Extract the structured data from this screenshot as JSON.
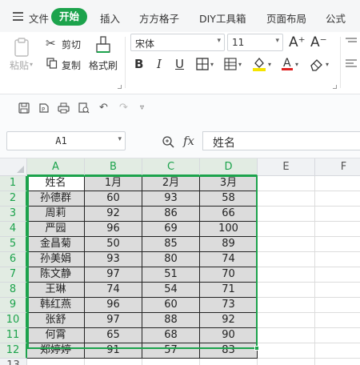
{
  "menubar": {
    "items": [
      "文件",
      "开始",
      "插入",
      "方方格子",
      "DIY工具箱",
      "页面布局",
      "公式"
    ],
    "active": "开始"
  },
  "ribbon": {
    "paste": "粘贴",
    "cut": "剪切",
    "copy": "复制",
    "format_painter": "格式刷",
    "font_name": "宋体",
    "font_size": "11",
    "bold": "B",
    "italic": "I",
    "underline": "U",
    "grow_font": "A⁺",
    "shrink_font": "A⁻"
  },
  "formula": {
    "name_box": "A1",
    "fx_label": "fx",
    "content": "姓名"
  },
  "grid": {
    "columns": [
      "A",
      "B",
      "C",
      "D",
      "E",
      "F"
    ],
    "row_numbers": [
      "1",
      "2",
      "3",
      "4",
      "5",
      "6",
      "7",
      "8",
      "9",
      "10",
      "11",
      "12",
      "13"
    ],
    "headers": [
      "姓名",
      "1月",
      "2月",
      "3月"
    ],
    "rows": [
      [
        "孙德群",
        "60",
        "93",
        "58"
      ],
      [
        "周莉",
        "92",
        "86",
        "66"
      ],
      [
        "严园",
        "96",
        "69",
        "100"
      ],
      [
        "金昌菊",
        "50",
        "85",
        "89"
      ],
      [
        "孙美娟",
        "93",
        "80",
        "74"
      ],
      [
        "陈文静",
        "97",
        "51",
        "70"
      ],
      [
        "王琳",
        "74",
        "54",
        "71"
      ],
      [
        "韩红燕",
        "96",
        "60",
        "73"
      ],
      [
        "张舒",
        "97",
        "88",
        "92"
      ],
      [
        "何霄",
        "65",
        "68",
        "90"
      ],
      [
        "郑婷婷",
        "91",
        "57",
        "83"
      ]
    ]
  },
  "colors": {
    "accent": "#1ca34c",
    "selection_fill": "#dcdcdc",
    "font_color_underline": "#e02020",
    "highlight_yellow": "#f5e400"
  }
}
